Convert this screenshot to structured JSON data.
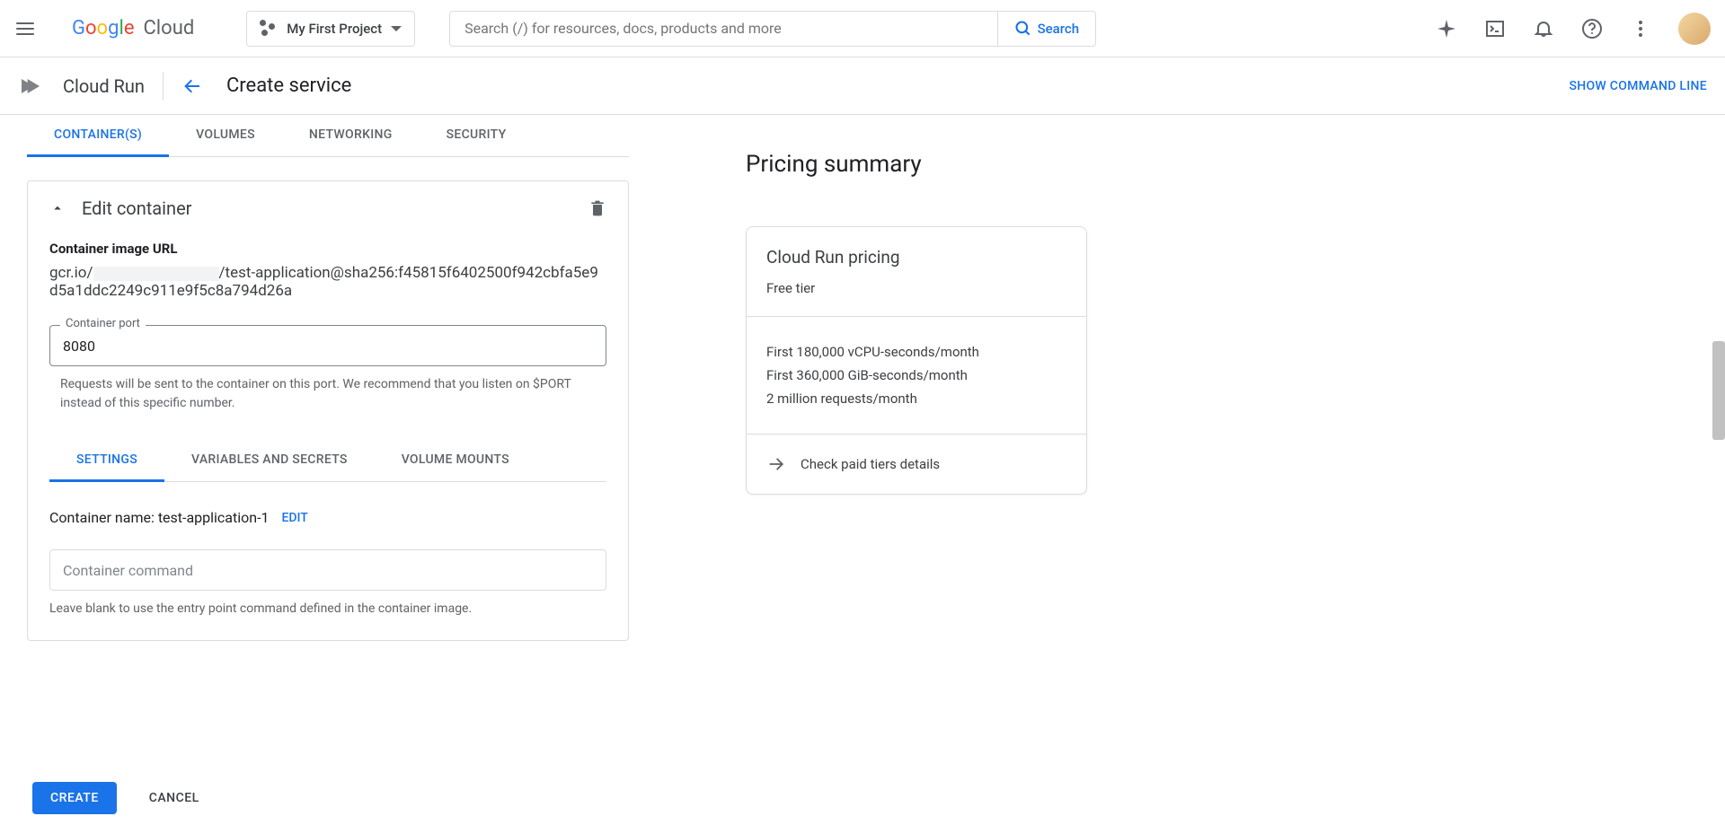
{
  "header": {
    "project_name": "My First Project",
    "search_placeholder": "Search (/) for resources, docs, products and more",
    "search_button": "Search"
  },
  "subheader": {
    "product": "Cloud Run",
    "page_title": "Create service",
    "command_line_link": "SHOW COMMAND LINE"
  },
  "tabs": [
    "CONTAINER(S)",
    "VOLUMES",
    "NETWORKING",
    "SECURITY"
  ],
  "panel": {
    "title": "Edit container",
    "image_url_label": "Container image URL",
    "image_url_prefix": "gcr.io/",
    "image_url_suffix": "/test-application@sha256:f45815f6402500f942cbfa5e9d5a1ddc2249c911e9f5c8a794d26a",
    "port_label": "Container port",
    "port_value": "8080",
    "port_help": "Requests will be sent to the container on this port. We recommend that you listen on $PORT instead of this specific number.",
    "subtabs": [
      "SETTINGS",
      "VARIABLES AND SECRETS",
      "VOLUME MOUNTS"
    ],
    "container_name_label": "Container name:",
    "container_name_value": "test-application-1",
    "edit_link": "EDIT",
    "command_placeholder": "Container command",
    "command_help": "Leave blank to use the entry point command defined in the container image."
  },
  "pricing": {
    "heading": "Pricing summary",
    "card_title": "Cloud Run pricing",
    "tier": "Free tier",
    "lines": [
      "First 180,000 vCPU-seconds/month",
      "First 360,000 GiB-seconds/month",
      "2 million requests/month"
    ],
    "details_link": "Check paid tiers details"
  },
  "footer": {
    "create": "CREATE",
    "cancel": "CANCEL"
  }
}
